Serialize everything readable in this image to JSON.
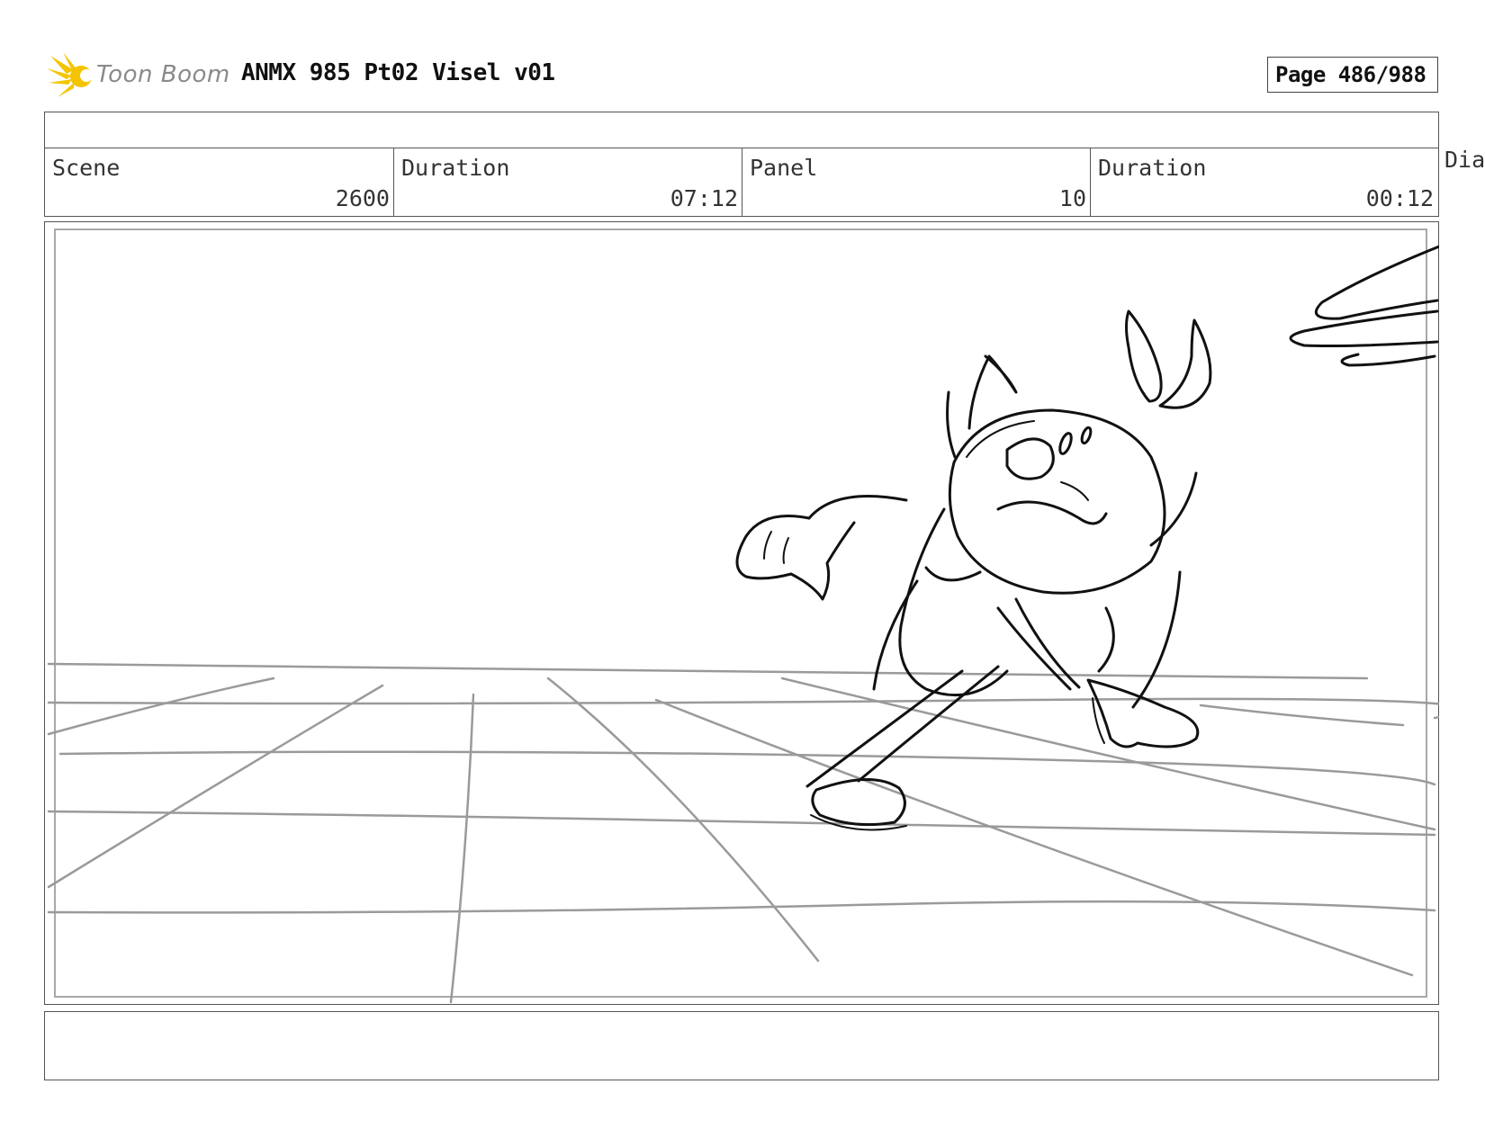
{
  "header": {
    "logo_text": "Toon Boom",
    "title": "ANMX 985 Pt02 Visel v01",
    "page_label": "Page 486/988"
  },
  "info": {
    "scene_label": "Scene",
    "scene_value": "2600",
    "scene_duration_label": "Duration",
    "scene_duration_value": "07:12",
    "panel_label": "Panel",
    "panel_value": "10",
    "panel_duration_label": "Duration",
    "panel_duration_value": "00:12",
    "overflow_label": "Dia"
  },
  "colors": {
    "logo_yellow": "#f5c400",
    "logo_text": "#8a8a8a",
    "border": "#555555",
    "sketch_ink": "#111111",
    "grid_lines": "#9a9a9a"
  },
  "icons": {
    "logo": "toon-boom-starburst-icon"
  }
}
